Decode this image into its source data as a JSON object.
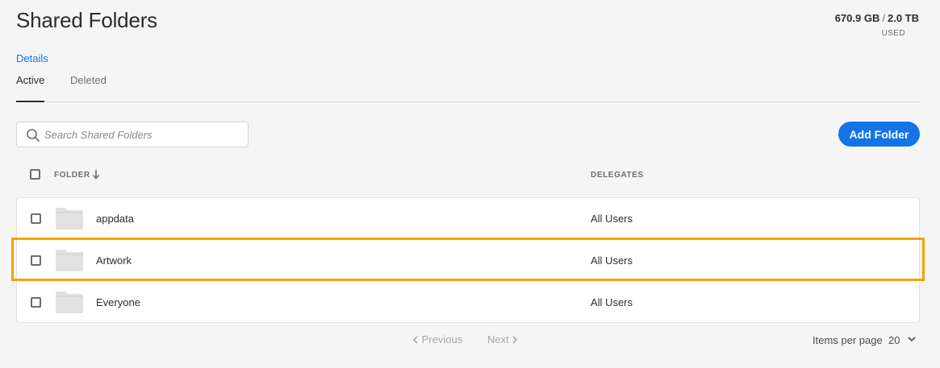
{
  "header": {
    "title": "Shared Folders",
    "storage_used": "670.9 GB",
    "storage_separator": "/",
    "storage_total": "2.0 TB",
    "storage_label": "USED",
    "details_link": "Details"
  },
  "tabs": [
    {
      "label": "Active",
      "active": true
    },
    {
      "label": "Deleted",
      "active": false
    }
  ],
  "search": {
    "placeholder": "Search Shared Folders",
    "value": ""
  },
  "actions": {
    "add_folder_label": "Add Folder"
  },
  "table": {
    "columns": {
      "folder": "FOLDER",
      "delegates": "DELEGATES"
    },
    "rows": [
      {
        "name": "appdata",
        "delegates": "All Users"
      },
      {
        "name": "Artwork",
        "delegates": "All Users",
        "highlighted": true
      },
      {
        "name": "Everyone",
        "delegates": "All Users"
      }
    ]
  },
  "pagination": {
    "previous_label": "Previous",
    "next_label": "Next",
    "items_per_page_label": "Items per page",
    "items_per_page_value": "20"
  },
  "colors": {
    "accent": "#1473e6",
    "highlight": "#f5a300",
    "background": "#f5f5f5"
  },
  "icons": [
    "search-icon",
    "sort-down-icon",
    "folder-icon",
    "chevron-left-icon",
    "chevron-right-icon",
    "chevron-down-icon"
  ]
}
